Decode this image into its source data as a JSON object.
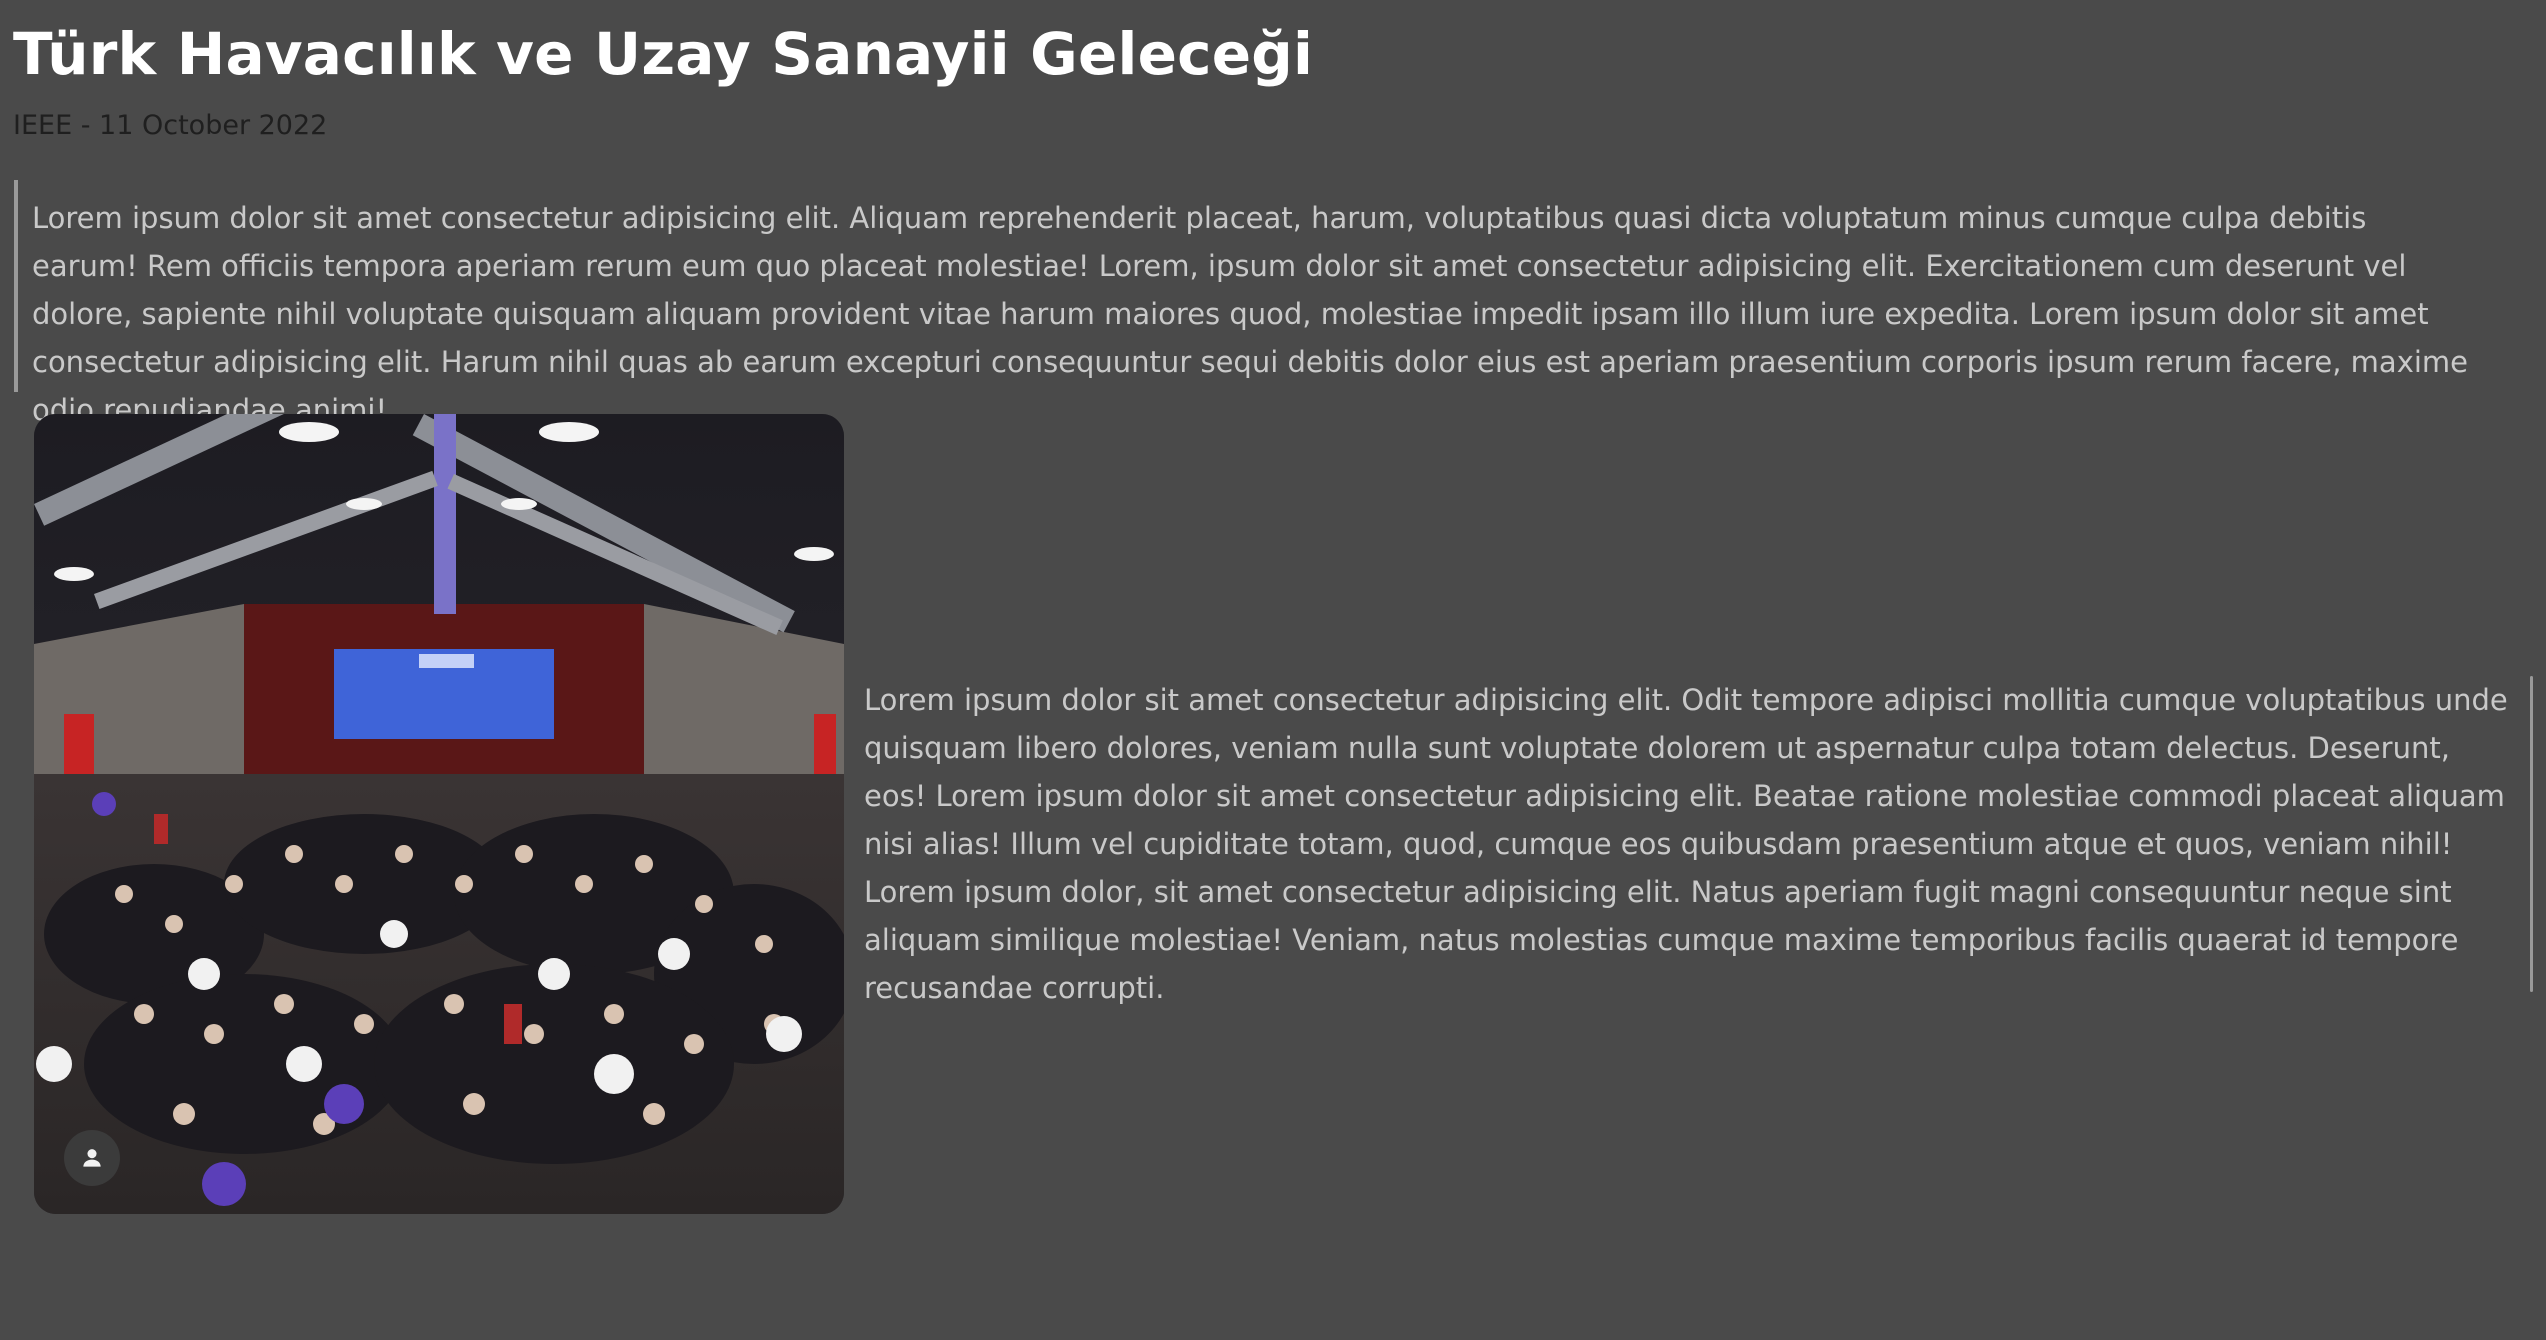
{
  "article": {
    "title": "Türk Havacılık ve Uzay Sanayii Geleceği",
    "meta": "IEEE - 11 October 2022",
    "quote": "Lorem ipsum dolor sit amet consectetur adipisicing elit. Aliquam reprehenderit placeat, harum, voluptatibus quasi dicta voluptatum minus cumque culpa debitis earum! Rem officiis tempora aperiam rerum eum quo placeat molestiae! Lorem, ipsum dolor sit amet consectetur adipisicing elit. Exercitationem cum deserunt vel dolore, sapiente nihil voluptate quisquam aliquam provident vitae harum maiores quod, molestiae impedit ipsam illo illum iure expedita. Lorem ipsum dolor sit amet consectetur adipisicing elit. Harum nihil quas ab earum excepturi consequuntur sequi debitis dolor eius est aperiam praesentium corporis ipsum rerum facere, maxime odio repudiandae animi!",
    "body": "Lorem ipsum dolor sit amet consectetur adipisicing elit. Odit tempore adipisci mollitia cumque voluptatibus unde quisquam libero dolores, veniam nulla sunt voluptate dolorem ut aspernatur culpa totam delectus. Deserunt, eos! Lorem ipsum dolor sit amet consectetur adipisicing elit. Beatae ratione molestiae commodi placeat aliquam nisi alias! Illum vel cupiditate totam, quod, cumque eos quibusdam praesentium atque et quos, veniam nihil! Lorem ipsum dolor, sit amet consectetur adipisicing elit. Natus aperiam fugit magni consequuntur neque sint aliquam similique molestiae! Veniam, natus molestias cumque maxime temporibus facilis quaerat id tempore recusandae corrupti."
  },
  "photo": {
    "avatar_icon": "person-icon"
  },
  "colors": {
    "background": "#4a4a4a",
    "title": "#ffffff",
    "meta": "#1f1f1f",
    "text": "#c9c9c9",
    "quote_border": "#9a9a9a"
  }
}
